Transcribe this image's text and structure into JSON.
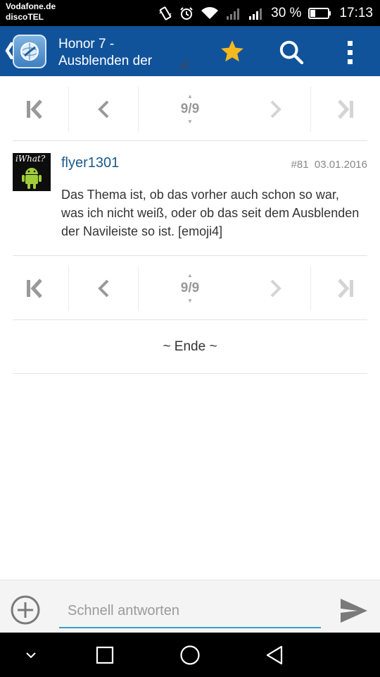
{
  "status_bar": {
    "carrier_line1": "Vodafone.de",
    "carrier_line2": "discoTEL",
    "battery_percent": "30 %",
    "battery_level": 0.3,
    "time": "17:13"
  },
  "app_bar": {
    "title": "Honor 7 - Ausblenden der",
    "icons": [
      "back-chevron-icon",
      "app-logo-icon",
      "star-icon",
      "search-icon",
      "more-vert-icon"
    ],
    "colors": {
      "background": "#10539b",
      "star": "#f6b91c"
    }
  },
  "pagination": {
    "page_indicator": "9/9",
    "current_page": 9,
    "total_pages": 9,
    "buttons": [
      "first-page-icon",
      "prev-page-icon",
      "next-page-icon",
      "last-page-icon"
    ]
  },
  "post": {
    "avatar_text": "iWhat?",
    "username": "flyer1301",
    "post_number": "#81",
    "date": "03.01.2016",
    "body": "Das Thema ist, ob das vorher auch schon so war, was ich nicht weiß, oder ob das seit dem Ausblenden der Navileiste so ist. [emoji4]"
  },
  "end_label": "~ Ende ~",
  "reply": {
    "placeholder": "Schnell antworten",
    "colors": {
      "underline": "#3aa0c8"
    }
  },
  "nav_bar": {
    "buttons": [
      "hide-keyboard-icon",
      "recents-icon",
      "home-icon",
      "back-icon"
    ]
  }
}
